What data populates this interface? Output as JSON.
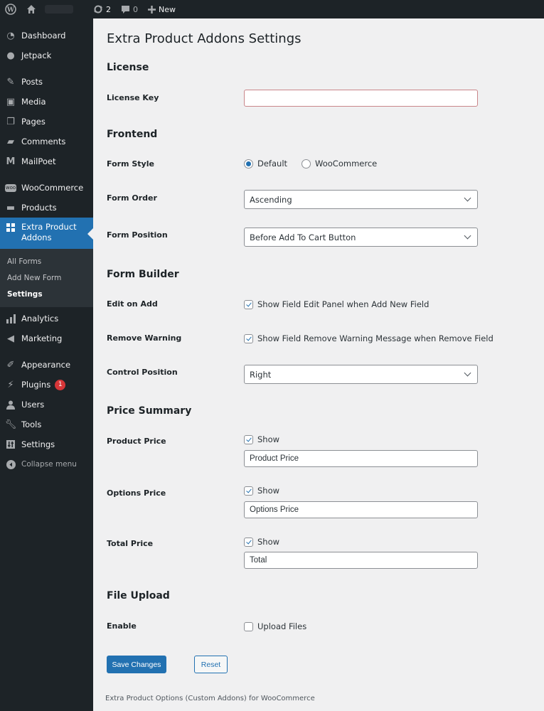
{
  "adminbar": {
    "updates_count": "2",
    "comments_count": "0",
    "new_label": "New"
  },
  "sidebar": {
    "items_top": [
      {
        "label": "Dashboard",
        "icon": "dashboard-icon"
      },
      {
        "label": "Jetpack",
        "icon": "jetpack-icon"
      }
    ],
    "items_content": [
      {
        "label": "Posts",
        "icon": "pin-icon"
      },
      {
        "label": "Media",
        "icon": "media-icon"
      },
      {
        "label": "Pages",
        "icon": "pages-icon"
      },
      {
        "label": "Comments",
        "icon": "comment-icon"
      },
      {
        "label": "MailPoet",
        "icon": "mailpoet-icon"
      }
    ],
    "items_shop": [
      {
        "label": "WooCommerce",
        "icon": "woocommerce-icon"
      },
      {
        "label": "Products",
        "icon": "archive-icon"
      }
    ],
    "active": {
      "label": "Extra Product Addons",
      "icon": "grid-icon"
    },
    "submenu": [
      {
        "label": "All Forms"
      },
      {
        "label": "Add New Form"
      },
      {
        "label": "Settings",
        "current": true
      }
    ],
    "items_after": [
      {
        "label": "Analytics",
        "icon": "bar-chart-icon"
      },
      {
        "label": "Marketing",
        "icon": "megaphone-icon"
      }
    ],
    "items_admin": [
      {
        "label": "Appearance",
        "icon": "brush-icon"
      },
      {
        "label": "Plugins",
        "icon": "plugin-icon",
        "badge": "1"
      },
      {
        "label": "Users",
        "icon": "user-icon"
      },
      {
        "label": "Tools",
        "icon": "wrench-icon"
      },
      {
        "label": "Settings",
        "icon": "settings-icon"
      }
    ],
    "collapse_label": "Collapse menu"
  },
  "page": {
    "title": "Extra Product Addons Settings",
    "sections": {
      "license": "License",
      "frontend": "Frontend",
      "form_builder": "Form Builder",
      "price_summary": "Price Summary",
      "file_upload": "File Upload"
    },
    "license_key": {
      "label": "License Key",
      "value": ""
    },
    "form_style": {
      "label": "Form Style",
      "options": [
        "Default",
        "WooCommerce"
      ],
      "selected": "Default"
    },
    "form_order": {
      "label": "Form Order",
      "value": "Ascending"
    },
    "form_position": {
      "label": "Form Position",
      "value": "Before Add To Cart Button"
    },
    "edit_on_add": {
      "label": "Edit on Add",
      "checkbox_label": "Show Field Edit Panel when Add New Field",
      "checked": true
    },
    "remove_warning": {
      "label": "Remove Warning",
      "checkbox_label": "Show Field Remove Warning Message when Remove Field",
      "checked": true
    },
    "control_position": {
      "label": "Control Position",
      "value": "Right"
    },
    "product_price": {
      "label": "Product Price",
      "checkbox_label": "Show",
      "checked": true,
      "value": "Product Price"
    },
    "options_price": {
      "label": "Options Price",
      "checkbox_label": "Show",
      "checked": true,
      "value": "Options Price"
    },
    "total_price": {
      "label": "Total Price",
      "checkbox_label": "Show",
      "checked": true,
      "value": "Total"
    },
    "enable_upload": {
      "label": "Enable",
      "checkbox_label": "Upload Files",
      "checked": false
    },
    "save_label": "Save Changes",
    "reset_label": "Reset",
    "footer": "Extra Product Options (Custom Addons) for WooCommerce"
  },
  "colors": {
    "accent": "#2271b1",
    "sidebar_bg": "#1d2327",
    "error_border": "#c9868a",
    "badge": "#d63638"
  }
}
